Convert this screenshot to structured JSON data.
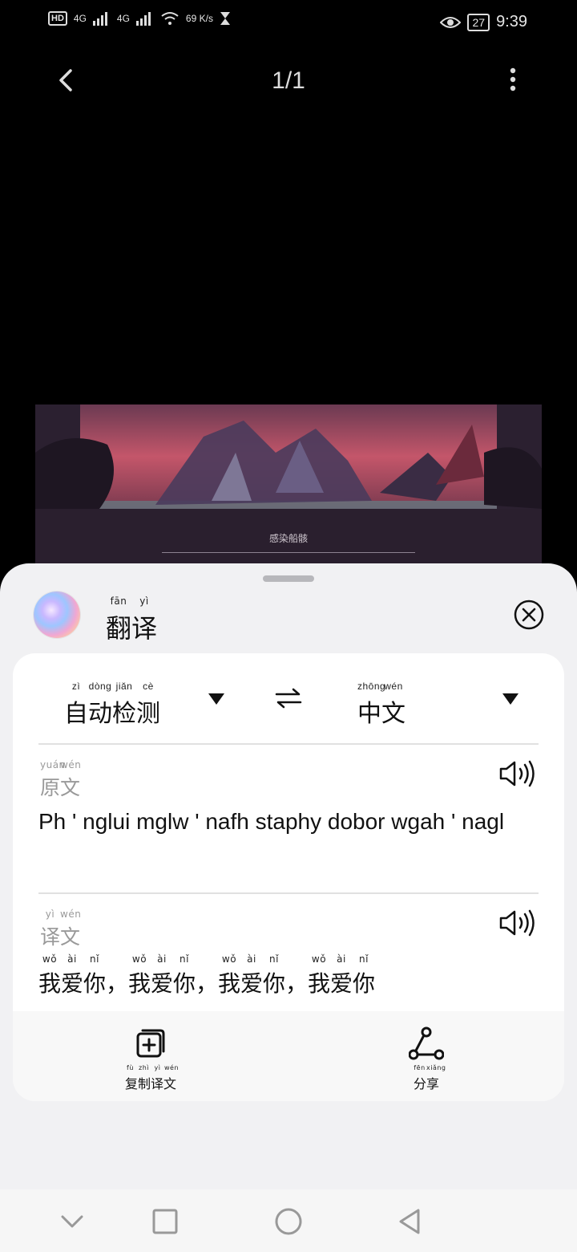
{
  "status_bar": {
    "left_items": [
      "HD",
      "4G",
      "4G",
      "69",
      "K/s"
    ],
    "right_items": [
      "27",
      "9:39"
    ],
    "time": "9:39",
    "battery": "27"
  },
  "top_nav": {
    "page_counter": "1/1"
  },
  "image": {
    "caption": "感染船骸"
  },
  "sheet": {
    "title": "翻译",
    "title_pinyin": [
      "fān",
      "yì"
    ],
    "source_lang": "自动检测",
    "source_lang_pinyin": [
      "zì",
      "dòng",
      "jiǎn",
      "cè"
    ],
    "target_lang": "中文",
    "target_lang_pinyin": [
      "zhōng",
      "wén"
    ],
    "original_label": "原文",
    "original_label_pinyin": [
      "yuán",
      "wén"
    ],
    "original_text": "Ph ' nglui mglw ' nafh staphy dobor wgah ' nagl",
    "translated_label": "译文",
    "translated_label_pinyin": [
      "yì",
      "wén"
    ],
    "translated_text": "我爱你，我爱你，我爱你，我爱你",
    "translated_pinyin": [
      "wǒ",
      "ài",
      "nǐ",
      "wǒ",
      "ài",
      "nǐ",
      "wǒ",
      "ài",
      "nǐ",
      "wǒ",
      "ài",
      "nǐ"
    ],
    "copy_label": "复制译文",
    "copy_pinyin": [
      "fù",
      "zhì",
      "yì",
      "wén"
    ],
    "share_label": "分享",
    "share_pinyin": [
      "fēn",
      "xiǎng"
    ]
  },
  "colors": {
    "sheet_bg": "#f1f1f3",
    "card_bg": "#ffffff",
    "muted_text": "#999999"
  }
}
